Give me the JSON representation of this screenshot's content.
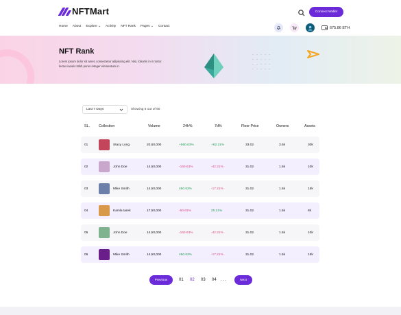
{
  "brand": {
    "name": "NFTMart",
    "accent": "#6c2bd9"
  },
  "header": {
    "connect_label": "Connect Wallet",
    "search_icon": "search-icon"
  },
  "nav": {
    "items": [
      "Home",
      "About",
      "Explore",
      "Activity",
      "NFT Rank",
      "Pages",
      "Contact"
    ],
    "balance": "675.86 ETH"
  },
  "hero": {
    "title": "NFT Rank",
    "subtitle": "Lorem ipsum dolor sit amet, consectetur adipiscing elit. Nisi, lobortis in in tortor lectus iaculis Nibh purus integer elementum in."
  },
  "filter": {
    "selected": "Last 7 Days",
    "showing": "Showing 6 out of 60"
  },
  "table": {
    "headers": [
      "SL.",
      "Collection",
      "Volume",
      "24h%",
      "7d%",
      "Floor Price",
      "Owners",
      "Assets"
    ],
    "rows": [
      {
        "sl": "01",
        "name": "Stacy Long",
        "volume": "20,50,000",
        "h24": "+560.63%",
        "d7": "+62.21%",
        "floor": "33.02",
        "owners": "3.6k",
        "assets": "30k",
        "h24dir": "pos",
        "d7dir": "pos",
        "thumb": "#c2455c"
      },
      {
        "sl": "02",
        "name": "John Doe",
        "volume": "14,50,000",
        "h24": "-160.63%",
        "d7": "-42.21%",
        "floor": "31.02",
        "owners": "1.6k",
        "assets": "10k",
        "h24dir": "neg",
        "d7dir": "neg",
        "thumb": "#c9a7cc"
      },
      {
        "sl": "03",
        "name": "Mike Smith",
        "volume": "14,50,000",
        "h24": "450.63%",
        "d7": "-17.21%",
        "floor": "31.02",
        "owners": "1.6k",
        "assets": "15k",
        "h24dir": "pos",
        "d7dir": "neg",
        "thumb": "#6c7fa8"
      },
      {
        "sl": "04",
        "name": "Kamla tarek",
        "volume": "17,50,000",
        "h24": "-50.63%",
        "d7": "25.21%",
        "floor": "31.02",
        "owners": "1.6k",
        "assets": "8k",
        "h24dir": "neg",
        "d7dir": "pos",
        "thumb": "#d89a4a"
      },
      {
        "sl": "05",
        "name": "John Doe",
        "volume": "14,50,000",
        "h24": "-160.63%",
        "d7": "-42.21%",
        "floor": "31.02",
        "owners": "1.6k",
        "assets": "10k",
        "h24dir": "neg",
        "d7dir": "neg",
        "thumb": "#7fb38f"
      },
      {
        "sl": "06",
        "name": "Mike Smith",
        "volume": "14,50,000",
        "h24": "450.63%",
        "d7": "-17.21%",
        "floor": "31.02",
        "owners": "1.6k",
        "assets": "15k",
        "h24dir": "pos",
        "d7dir": "neg",
        "thumb": "#6a1e8a"
      }
    ]
  },
  "pagination": {
    "previous": "Previous",
    "next": "Next",
    "pages": [
      "01",
      "02",
      "03",
      "04"
    ],
    "ellipsis": ". . .",
    "current": "02"
  }
}
